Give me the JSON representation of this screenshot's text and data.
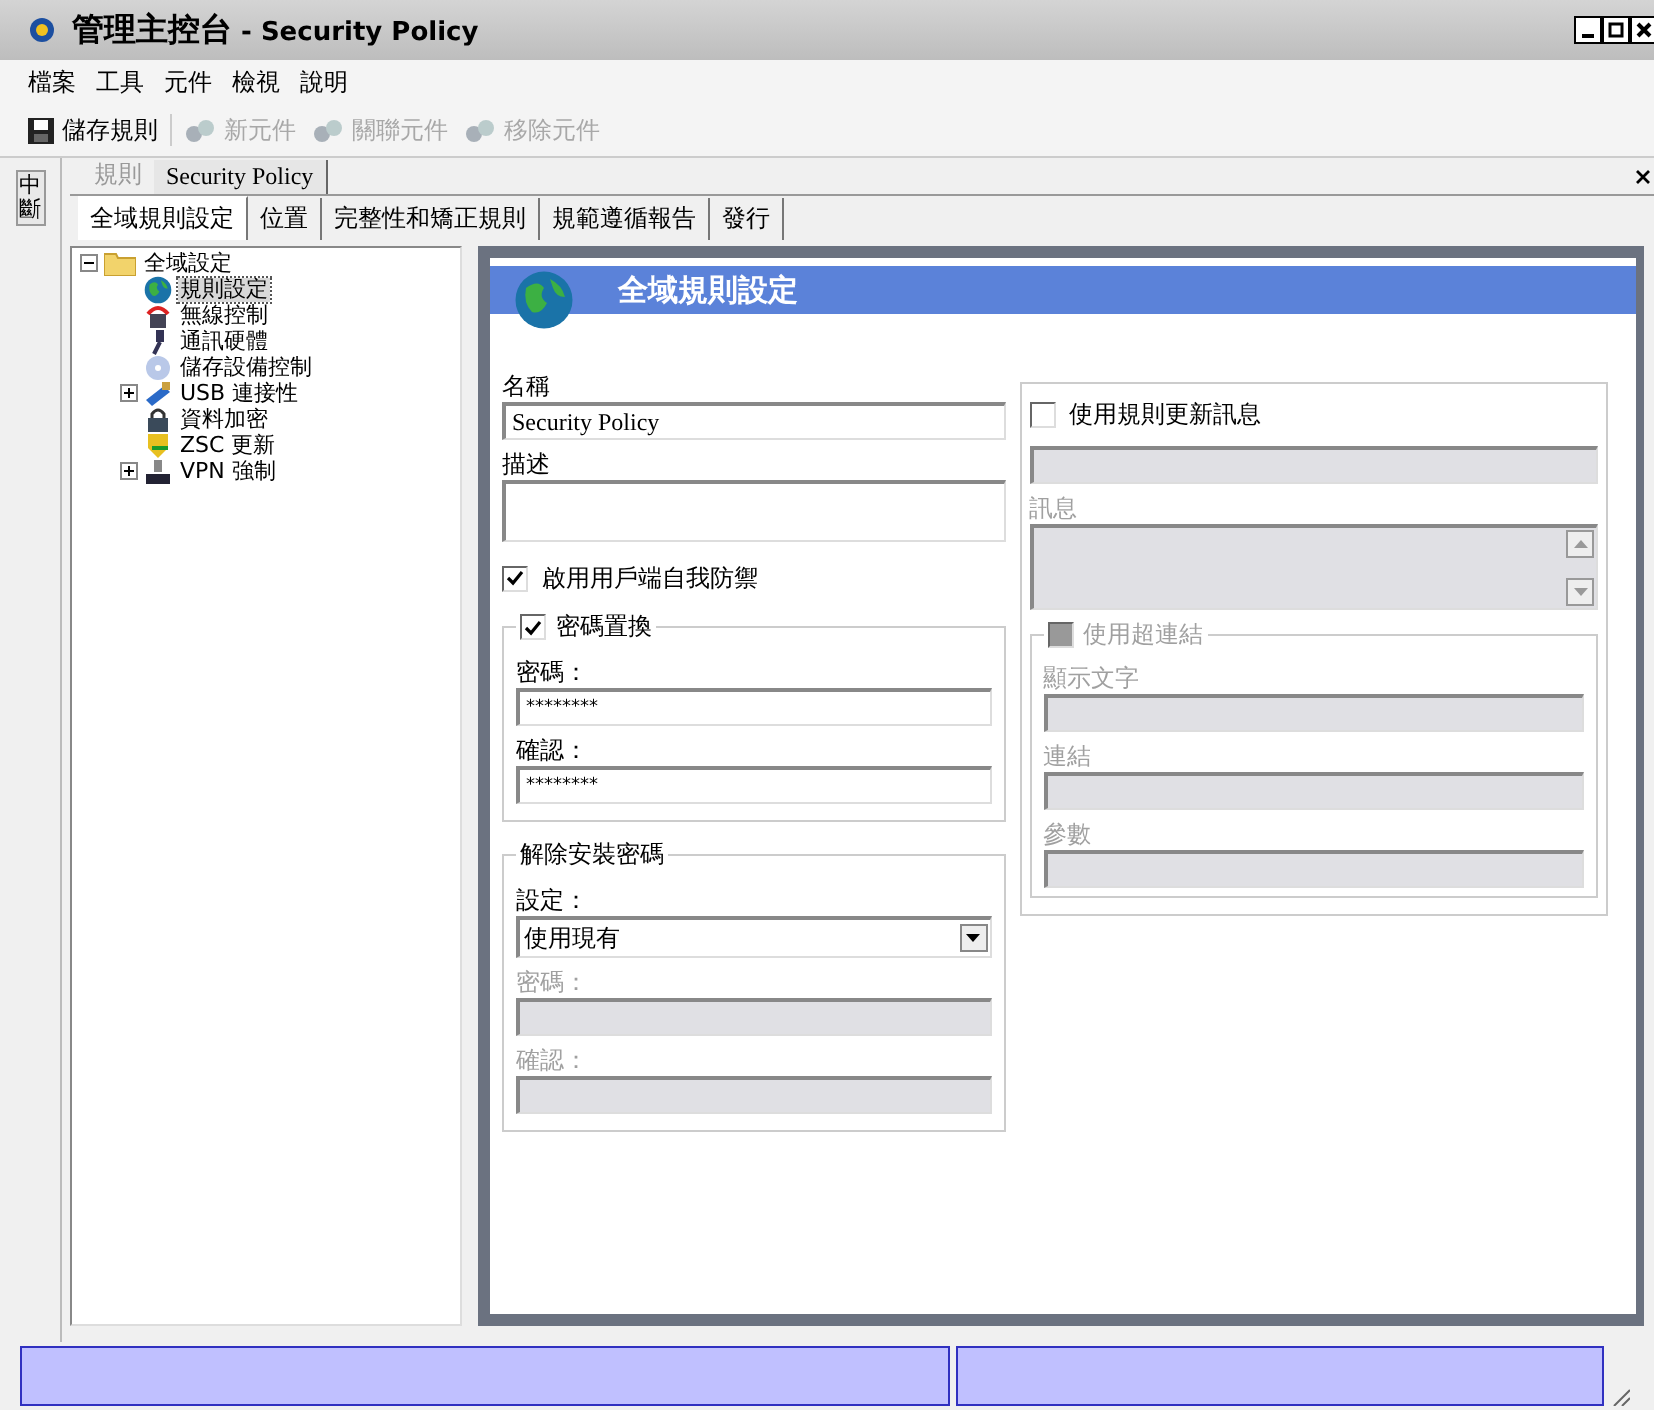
{
  "window": {
    "title_cjk": "管理主控台",
    "title_rest": " - Security Policy"
  },
  "menu": [
    "檔案",
    "工具",
    "元件",
    "檢視",
    "說明"
  ],
  "toolbar": [
    {
      "label": "儲存規則",
      "disabled": false
    },
    {
      "label": "新元件",
      "disabled": true
    },
    {
      "label": "關聯元件",
      "disabled": true
    },
    {
      "label": "移除元件",
      "disabled": true
    }
  ],
  "side_tab": "中斷",
  "doc_tabs": [
    {
      "label": "規則",
      "selected": false
    },
    {
      "label": "Security Policy",
      "selected": true
    }
  ],
  "tabs": [
    {
      "label": "全域規則設定",
      "selected": true
    },
    {
      "label": "位置",
      "selected": false
    },
    {
      "label": "完整性和矯正規則",
      "selected": false
    },
    {
      "label": "規範遵循報告",
      "selected": false
    },
    {
      "label": "發行",
      "selected": false
    }
  ],
  "tree": {
    "label": "全域設定",
    "expanded": true,
    "children": [
      {
        "label": "規則設定",
        "kind": "leaf",
        "selected": true
      },
      {
        "label": "無線控制",
        "kind": "leaf",
        "selected": false
      },
      {
        "label": "通訊硬體",
        "kind": "leaf",
        "selected": false
      },
      {
        "label": "儲存設備控制",
        "kind": "leaf",
        "selected": false
      },
      {
        "label": "USB 連接性",
        "kind": "branch",
        "expanded": false,
        "selected": false
      },
      {
        "label": "資料加密",
        "kind": "leaf",
        "selected": false
      },
      {
        "label": "ZSC 更新",
        "kind": "leaf",
        "selected": false
      },
      {
        "label": "VPN 強制",
        "kind": "branch",
        "expanded": false,
        "selected": false
      }
    ]
  },
  "panel": {
    "title": "全域規則設定",
    "name_label": "名稱",
    "name_value": "Security Policy",
    "description_label": "描述",
    "self_defense": {
      "label": "啟用用戶端自我防禦",
      "checked": true
    },
    "password_override": {
      "label": "密碼置換",
      "checked": true,
      "fields": [
        {
          "label": "密碼：",
          "value": "********",
          "disabled": false
        },
        {
          "label": "確認：",
          "value": "********",
          "disabled": false
        }
      ]
    },
    "uninstall": {
      "legend": "解除安裝密碼",
      "setting_label": "設定：",
      "setting_value": "使用現有",
      "fields": [
        {
          "label": "密碼：",
          "disabled": true
        },
        {
          "label": "確認：",
          "disabled": true
        }
      ]
    },
    "update_message": {
      "label": "使用規則更新訊息",
      "checked": false,
      "message_label": "訊息",
      "disabled": true
    },
    "hyperlink": {
      "label": "使用超連結",
      "checked": false,
      "disabled": true,
      "fields": [
        {
          "label": "顯示文字",
          "disabled": true
        },
        {
          "label": "連結",
          "disabled": true
        },
        {
          "label": "參數",
          "disabled": true
        }
      ]
    }
  }
}
